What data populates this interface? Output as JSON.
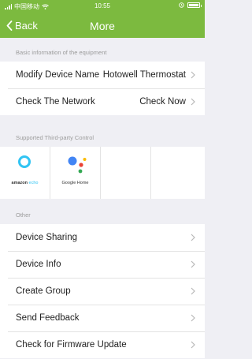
{
  "status_bar": {
    "carrier": "中国移动",
    "time": "10:55"
  },
  "nav": {
    "back_label": "Back",
    "title": "More"
  },
  "sections": {
    "equipment": {
      "header": "Basic information of the equipment",
      "rows": [
        {
          "label": "Modify Device Name",
          "value": "Hotowell Thermostat"
        },
        {
          "label": "Check The Network",
          "value": "Check Now"
        }
      ]
    },
    "third_party": {
      "header": "Supported Third-party Control",
      "services": [
        {
          "icon": "amazon-echo-icon",
          "label_bold": "amazon",
          "label_light": " echo"
        },
        {
          "icon": "google-home-icon",
          "label": "Google Home"
        }
      ]
    },
    "other": {
      "header": "Other",
      "rows": [
        {
          "label": "Device Sharing"
        },
        {
          "label": "Device Info"
        },
        {
          "label": "Create Group"
        },
        {
          "label": "Send Feedback"
        },
        {
          "label": "Check for Firmware Update"
        }
      ]
    }
  },
  "colors": {
    "accent": "#7cba3f",
    "background": "#efeff4",
    "section_text": "#9b9b9b",
    "echo_blue": "#31c4f3"
  }
}
